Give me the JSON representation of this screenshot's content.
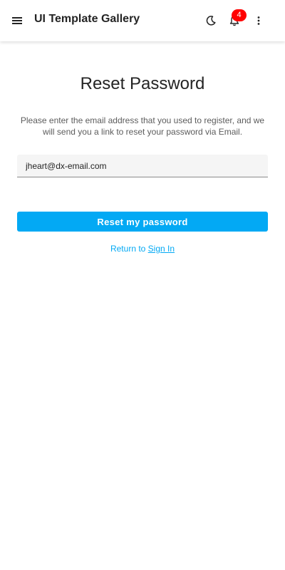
{
  "header": {
    "title": "UI Template Gallery",
    "notification_count": "4",
    "icons": {
      "menu": "menu-icon",
      "theme": "moon-icon",
      "notifications": "bell-icon",
      "more": "more-vertical-icon"
    }
  },
  "form": {
    "title": "Reset Password",
    "description": "Please enter the email address that you used to register, and we will send you a link to reset your password via Email.",
    "email_value": "jheart@dx-email.com",
    "submit_label": "Reset my password",
    "return_prefix": "Return to ",
    "sign_in_link": "Sign In"
  },
  "colors": {
    "accent": "#03a9f4",
    "badge": "#ff0000",
    "text": "#242424",
    "muted_text": "#5c5c5c"
  }
}
